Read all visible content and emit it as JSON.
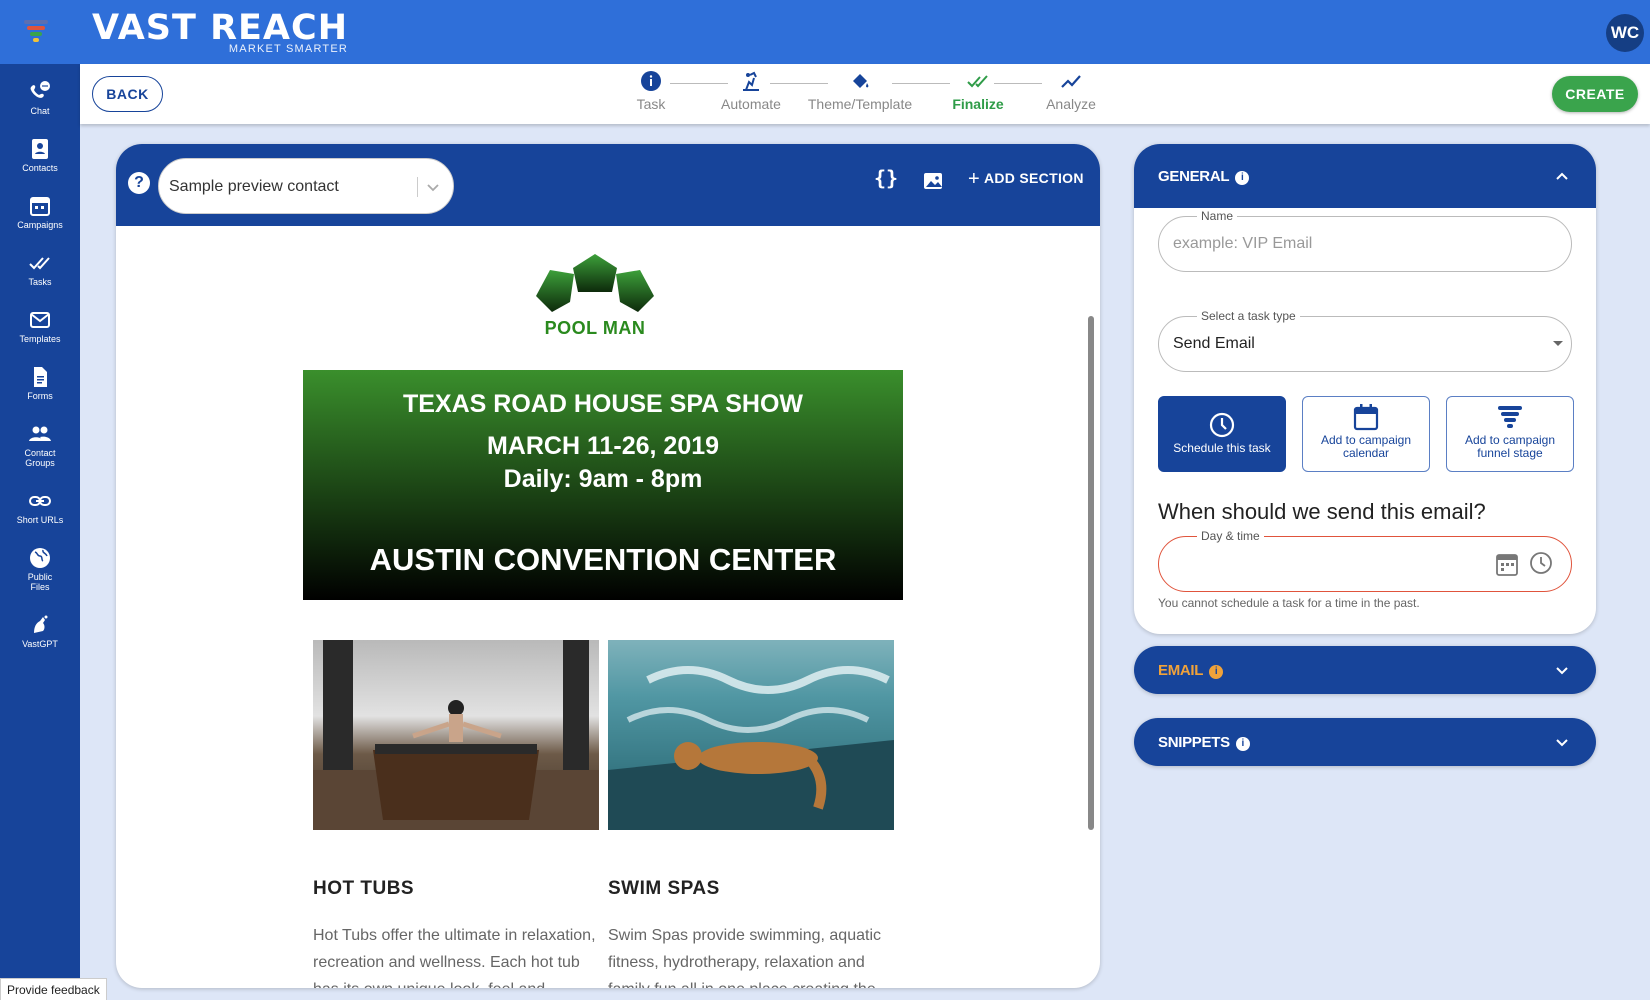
{
  "brand": {
    "name": "VAST REACH",
    "tagline": "MARKET SMARTER"
  },
  "user": {
    "initials": "WC"
  },
  "sidebar": {
    "items": [
      {
        "label": "Chat",
        "icon": "chat-icon"
      },
      {
        "label": "Contacts",
        "icon": "contacts-icon"
      },
      {
        "label": "Campaigns",
        "icon": "campaigns-icon"
      },
      {
        "label": "Tasks",
        "icon": "tasks-icon"
      },
      {
        "label": "Templates",
        "icon": "templates-icon"
      },
      {
        "label": "Forms",
        "icon": "forms-icon"
      },
      {
        "label": "Contact Groups",
        "icon": "contact-groups-icon"
      },
      {
        "label": "Short URLs",
        "icon": "link-icon"
      },
      {
        "label": "Public Files",
        "icon": "globe-icon"
      },
      {
        "label": "VastGPT",
        "icon": "vastgpt-icon"
      }
    ]
  },
  "wizard": {
    "back_label": "BACK",
    "create_label": "CREATE",
    "steps": [
      {
        "label": "Task",
        "state": "done"
      },
      {
        "label": "Automate",
        "state": "done"
      },
      {
        "label": "Theme/Template",
        "state": "done"
      },
      {
        "label": "Finalize",
        "state": "active"
      },
      {
        "label": "Analyze",
        "state": "pending"
      }
    ]
  },
  "editor": {
    "preview_contact": "Sample preview contact",
    "add_section_label": "ADD SECTION",
    "email": {
      "logo_text": "POOL MAN",
      "banner": {
        "line1": "TEXAS ROAD HOUSE SPA SHOW",
        "line2": "MARCH 11-26, 2019",
        "line3": "Daily: 9am - 8pm",
        "line4": "AUSTIN CONVENTION CENTER"
      },
      "columns": [
        {
          "title": "HOT TUBS",
          "text": "Hot Tubs offer the ultimate in relaxation, recreation and wellness. Each hot tub has its own unique look, feel and"
        },
        {
          "title": "SWIM SPAS",
          "text": "Swim Spas provide swimming, aquatic fitness, hydrotherapy, relaxation and family fun all in one place creating the"
        }
      ]
    }
  },
  "general": {
    "title": "GENERAL",
    "name_label": "Name",
    "name_placeholder": "example: VIP Email",
    "task_type_label": "Select a task type",
    "task_type_value": "Send Email",
    "options": [
      {
        "label": "Schedule this task",
        "selected": true
      },
      {
        "label": "Add to campaign calendar",
        "selected": false
      },
      {
        "label": "Add to campaign funnel stage",
        "selected": false
      }
    ],
    "when_question": "When should we send this email?",
    "daytime_label": "Day & time",
    "error_text": "You cannot schedule a task for a time in the past."
  },
  "email_panel": {
    "title": "EMAIL"
  },
  "snippets_panel": {
    "title": "SNIPPETS"
  },
  "feedback_label": "Provide feedback",
  "colors": {
    "topbar": "#2f6fd9",
    "navy": "#17449a",
    "create": "#3aa44c",
    "finalize": "#2f9c48",
    "email_accent": "#f0a23a",
    "error": "#e0543c"
  }
}
